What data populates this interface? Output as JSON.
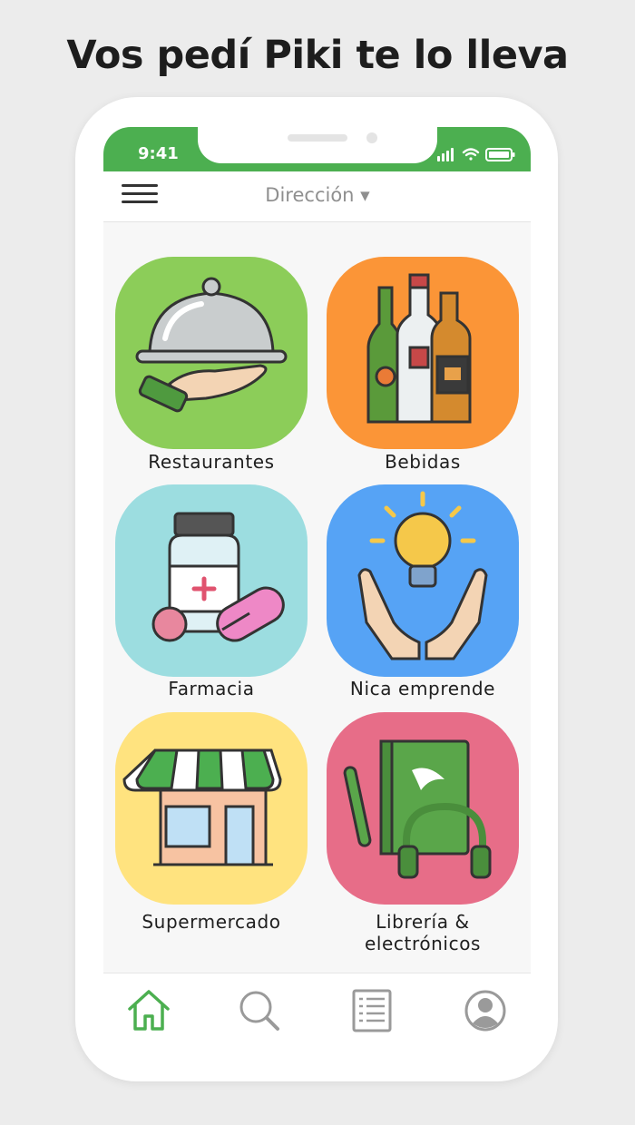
{
  "headline": "Vos pedí Piki te lo lleva",
  "status_bar": {
    "time": "9:41",
    "icons": [
      "signal-icon",
      "wifi-icon",
      "battery-icon"
    ]
  },
  "header": {
    "menu_icon": "hamburger-menu-icon",
    "address_label": "Dirección ▾"
  },
  "categories": [
    {
      "label": "Restaurantes",
      "color": "#8ccd59",
      "icon": "serving-cloche-icon"
    },
    {
      "label": "Bebidas",
      "color": "#fb9537",
      "icon": "bottles-icon"
    },
    {
      "label": "Farmacia",
      "color": "#9cdde0",
      "icon": "medicine-icon"
    },
    {
      "label": "Nica emprende",
      "color": "#56a3f5",
      "icon": "lightbulb-hands-icon"
    },
    {
      "label": "Supermercado",
      "color": "#ffe37f",
      "icon": "store-icon"
    },
    {
      "label": "Librería &\nelectrónicos",
      "color": "#e76d88",
      "icon": "book-headphones-icon"
    }
  ],
  "bottom_nav": [
    {
      "name": "home-icon",
      "active": true
    },
    {
      "name": "search-icon",
      "active": false
    },
    {
      "name": "orders-list-icon",
      "active": false
    },
    {
      "name": "profile-icon",
      "active": false
    }
  ],
  "colors": {
    "brand_green": "#4caf50",
    "nav_active": "#4caf50",
    "nav_inactive": "#9a9a9a"
  }
}
